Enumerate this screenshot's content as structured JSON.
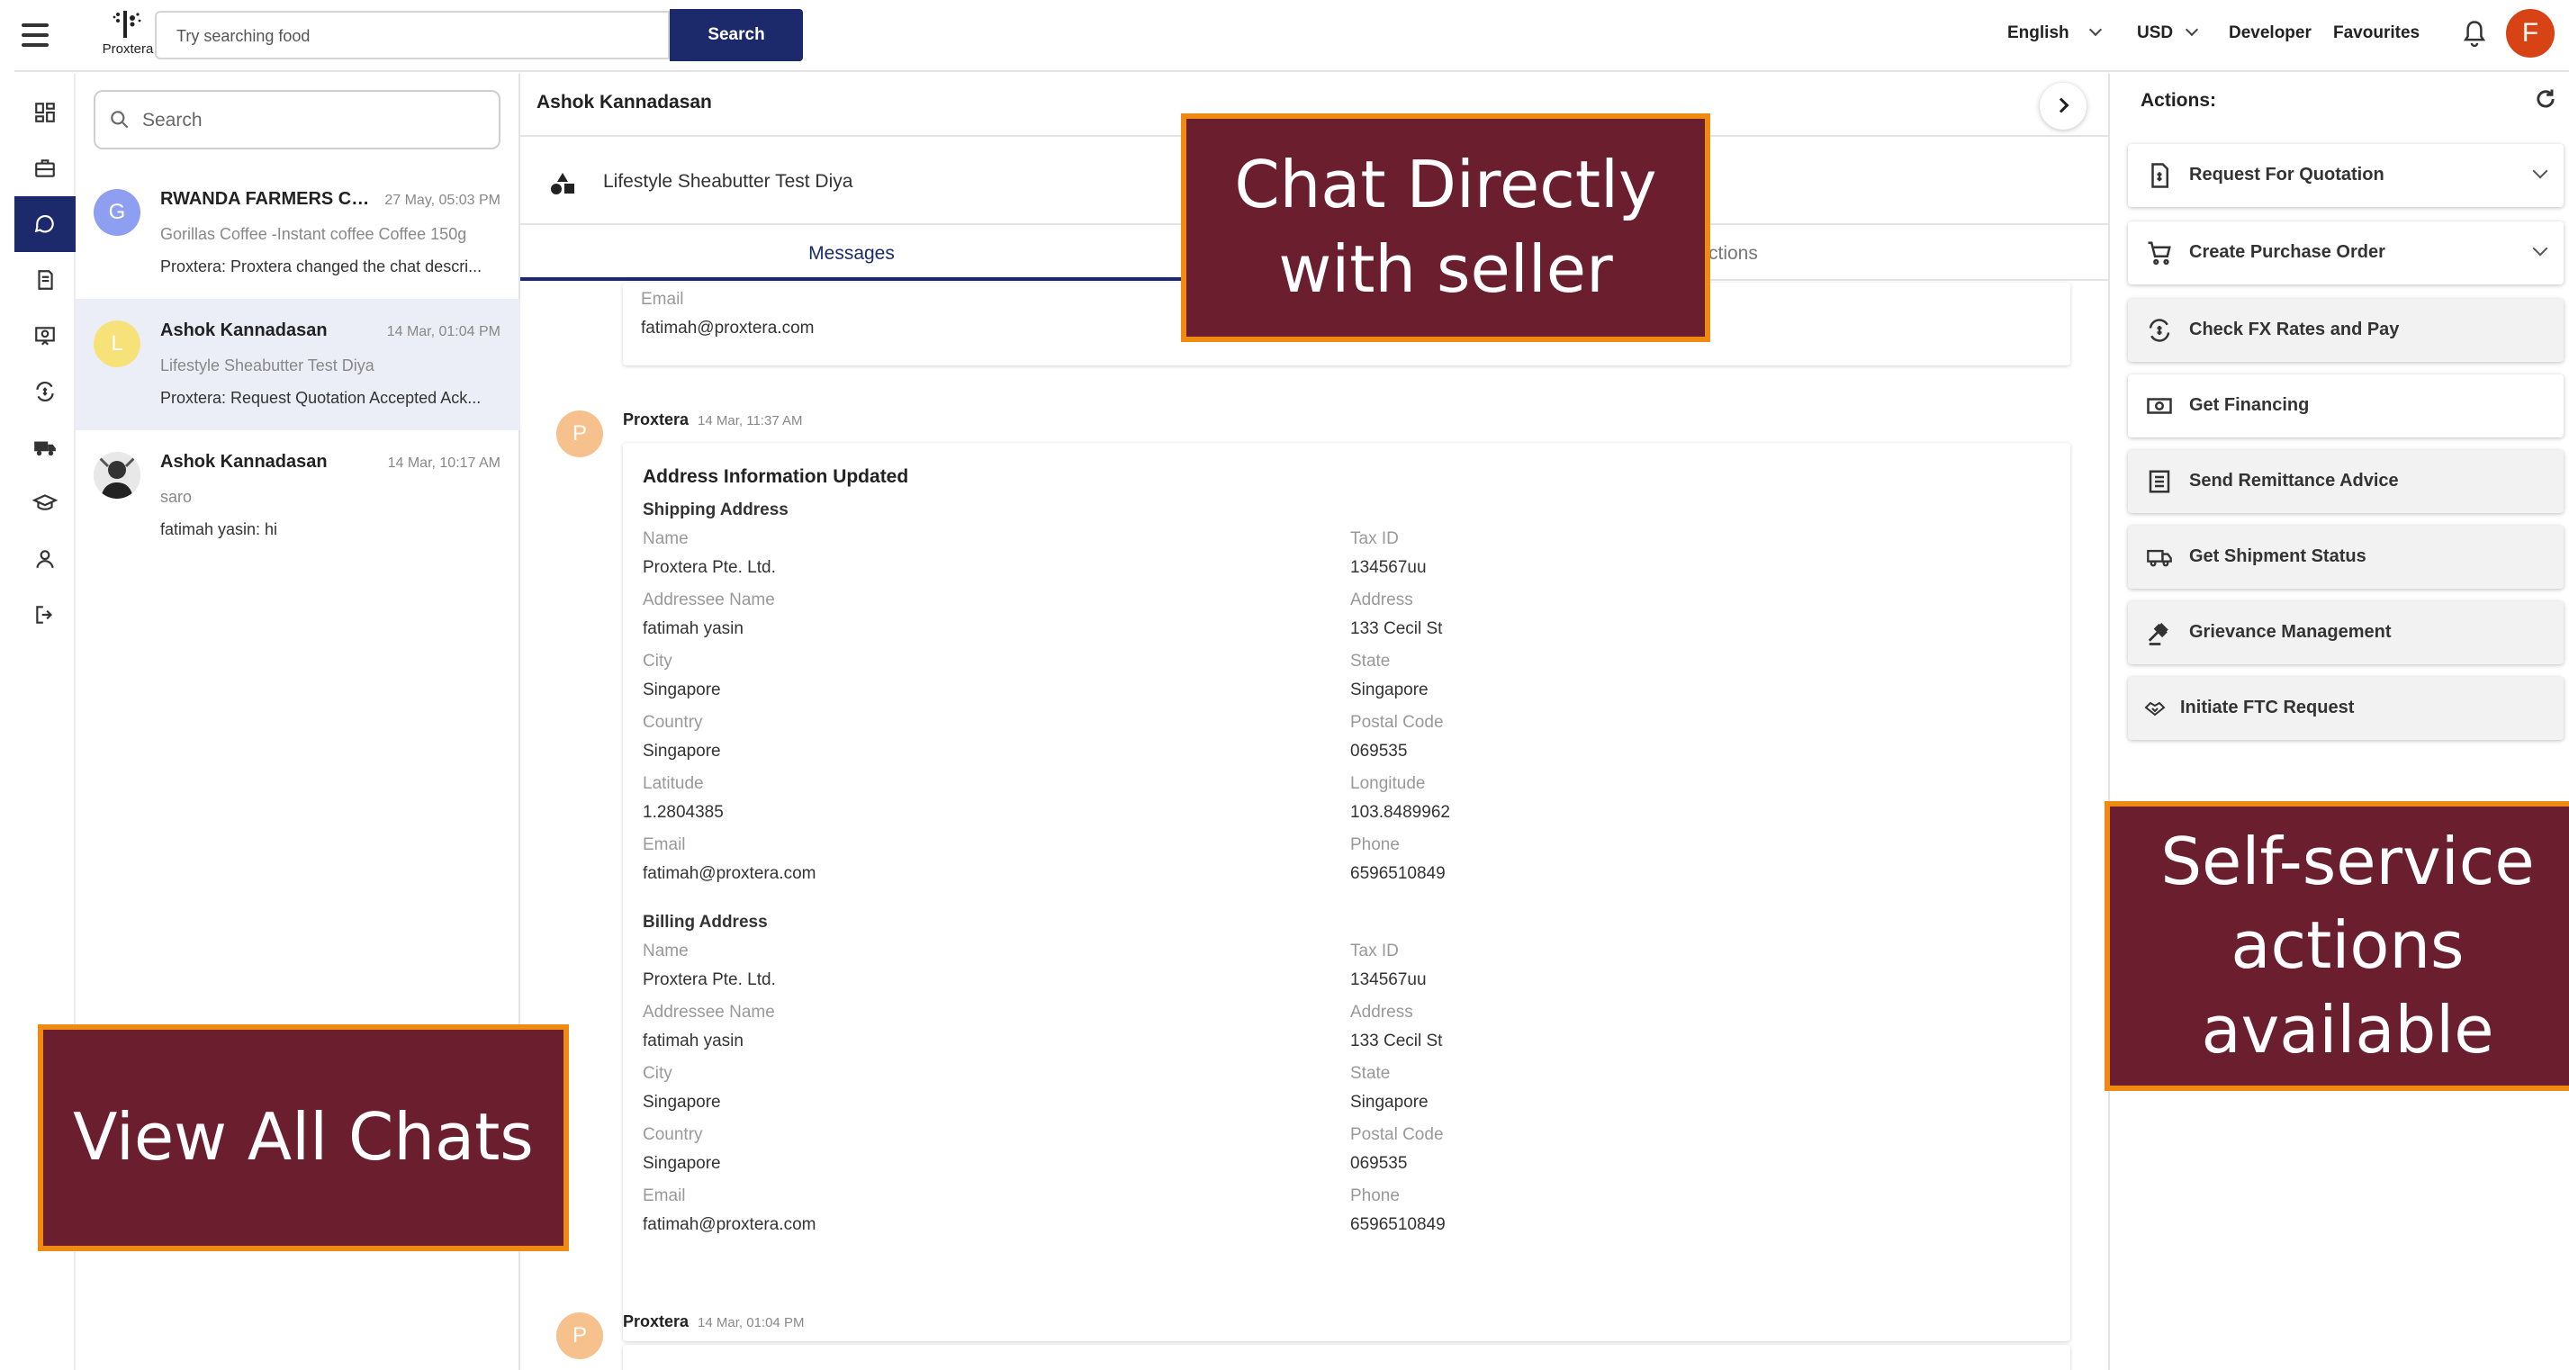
{
  "header": {
    "logo_text": "Proxtera",
    "search_placeholder": "Try searching food",
    "search_button": "Search",
    "language": "English",
    "currency": "USD",
    "developer": "Developer",
    "favourites": "Favourites",
    "avatar_initial": "F",
    "avatar_color": "#d84315",
    "brand_color": "#1c2a6b"
  },
  "sidebar_rail": {
    "icons": [
      "dashboard-icon",
      "briefcase-icon",
      "chat-icon",
      "catalog-icon",
      "certificate-icon",
      "currency-exchange-icon",
      "truck-icon",
      "graduation-cap-icon",
      "person-icon",
      "logout-icon"
    ],
    "active_index": 2
  },
  "chat_list": {
    "search_placeholder": "Search",
    "items": [
      {
        "initial": "G",
        "color": "#8e9ef0",
        "name": "RWANDA FARMERS CO...",
        "time": "27 May, 05:03 PM",
        "subtitle": "Gorillas Coffee -Instant coffee Coffee 150g",
        "last": "Proxtera: Proxtera changed the chat descri..."
      },
      {
        "initial": "L",
        "color": "#f7e27a",
        "name": "Ashok Kannadasan",
        "time": "14 Mar, 01:04 PM",
        "subtitle": "Lifestyle Sheabutter Test Diya",
        "last": "Proxtera: Request Quotation Accepted Ack..."
      },
      {
        "initial": "",
        "color": "#444444",
        "name": "Ashok Kannadasan",
        "time": "14 Mar, 10:17 AM",
        "subtitle": "saro",
        "last": "fatimah yasin: hi"
      }
    ]
  },
  "main": {
    "chat_name": "Ashok Kannadasan",
    "product_name": "Lifestyle Sheabutter Test Diya",
    "tabs": [
      "Messages",
      "ctions"
    ],
    "prev_email_label": "Email",
    "prev_email_value": "fatimah@proxtera.com",
    "message1": {
      "initial": "P",
      "from": "Proxtera",
      "time": "14 Mar, 11:37 AM",
      "title": "Address Information Updated",
      "shipping_title": "Shipping Address",
      "billing_title": "Billing Address",
      "shipping": [
        {
          "label": "Name",
          "value": "Proxtera Pte. Ltd."
        },
        {
          "label": "Tax ID",
          "value": "134567uu"
        },
        {
          "label": "Addressee Name",
          "value": "fatimah yasin"
        },
        {
          "label": "Address",
          "value": "133 Cecil St"
        },
        {
          "label": "City",
          "value": "Singapore"
        },
        {
          "label": "State",
          "value": "Singapore"
        },
        {
          "label": "Country",
          "value": "Singapore"
        },
        {
          "label": "Postal Code",
          "value": "069535"
        },
        {
          "label": "Latitude",
          "value": "1.2804385"
        },
        {
          "label": "Longitude",
          "value": "103.8489962"
        },
        {
          "label": "Email",
          "value": "fatimah@proxtera.com"
        },
        {
          "label": "Phone",
          "value": "6596510849"
        }
      ],
      "billing": [
        {
          "label": "Name",
          "value": "Proxtera Pte. Ltd."
        },
        {
          "label": "Tax ID",
          "value": "134567uu"
        },
        {
          "label": "Addressee Name",
          "value": "fatimah yasin"
        },
        {
          "label": "Address",
          "value": "133 Cecil St"
        },
        {
          "label": "City",
          "value": "Singapore"
        },
        {
          "label": "State",
          "value": "Singapore"
        },
        {
          "label": "Country",
          "value": "Singapore"
        },
        {
          "label": "Postal Code",
          "value": "069535"
        },
        {
          "label": "Email",
          "value": "fatimah@proxtera.com"
        },
        {
          "label": "Phone",
          "value": "6596510849"
        }
      ]
    },
    "message2": {
      "initial": "P",
      "from": "Proxtera",
      "time": "14 Mar, 01:04 PM"
    }
  },
  "actions": {
    "title": "Actions:",
    "items": [
      {
        "label": "Request For Quotation",
        "icon": "document-dollar-icon",
        "expandable": true
      },
      {
        "label": "Create Purchase Order",
        "icon": "cart-icon",
        "expandable": true
      },
      {
        "label": "Check FX Rates and Pay",
        "icon": "currency-exchange-icon",
        "expandable": false
      },
      {
        "label": "Get Financing",
        "icon": "money-icon",
        "expandable": false
      },
      {
        "label": "Send Remittance Advice",
        "icon": "list-document-icon",
        "expandable": false
      },
      {
        "label": "Get Shipment Status",
        "icon": "truck-icon",
        "expandable": false
      },
      {
        "label": "Grievance Management",
        "icon": "gavel-icon",
        "expandable": false
      },
      {
        "label": "Initiate FTC Request",
        "icon": "handshake-icon",
        "expandable": false
      }
    ]
  },
  "callouts": {
    "chat": "Chat Directly with seller",
    "actions": "Self-service actions available",
    "view": "View All Chats",
    "bg_color": "#6b1f2e",
    "border_color": "#f08a12"
  }
}
